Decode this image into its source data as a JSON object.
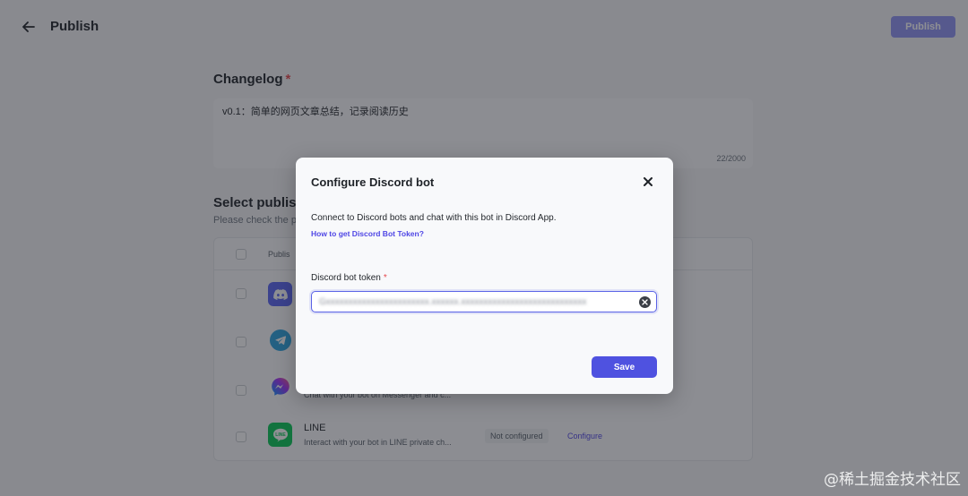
{
  "header": {
    "title": "Publish",
    "publish_label": "Publish"
  },
  "changelog": {
    "label": "Changelog",
    "required_mark": "*",
    "value": "v0.1：简单的网页文章总结，记录阅读历史",
    "count": "22/2000"
  },
  "select_section": {
    "title": "Select publishi",
    "subtitle": "Please check the p"
  },
  "table": {
    "header_label": "Publis",
    "rows": [
      {
        "icon": "discord-icon",
        "name": "",
        "desc": "",
        "status": "",
        "action": ""
      },
      {
        "icon": "telegram-icon",
        "name": "",
        "desc": "",
        "status": "",
        "action": ""
      },
      {
        "icon": "messenger-icon",
        "name": "",
        "desc": "Chat with your bot on Messenger and c...",
        "status": "",
        "action": ""
      },
      {
        "icon": "line-icon",
        "name": "LINE",
        "desc": "Interact with your bot in LINE private ch...",
        "status": "Not configured",
        "action": "Configure"
      }
    ]
  },
  "modal": {
    "title": "Configure Discord bot",
    "description": "Connect to Discord bots and chat with this bot in Discord App.",
    "link": "How to get Discord Bot Token?",
    "token_label": "Discord bot token",
    "required_mark": "*",
    "token_value": "Gxxxxxxxxxxxxxxxxxxxxxxx.xxxxxx.xxxxxxxxxxxxxxxxxxxxxxxxxxxx",
    "save_label": "Save"
  },
  "colors": {
    "accent": "#4f52e0",
    "discord": "#5865f2",
    "telegram": "#2aa3df",
    "line": "#06c755"
  },
  "watermark": "@稀土掘金技术社区"
}
